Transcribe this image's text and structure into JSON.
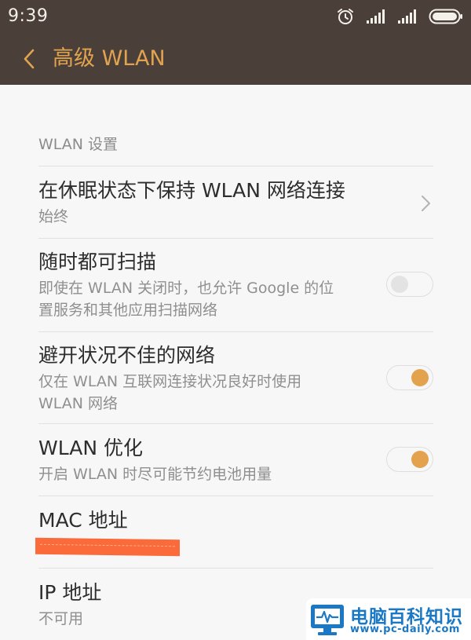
{
  "status_bar": {
    "time": "9:39",
    "icons": [
      "alarm-icon",
      "signal-icon",
      "signal-icon",
      "battery-icon"
    ]
  },
  "header": {
    "title": "高级 WLAN",
    "back_icon": "chevron-left-icon"
  },
  "section": {
    "label": "WLAN 设置"
  },
  "settings": [
    {
      "title": "在休眠状态下保持 WLAN 网络连接",
      "subtitle": "始终",
      "control": "chevron"
    },
    {
      "title": "随时都可扫描",
      "subtitle_lines": [
        "即使在 WLAN 关闭时，也允许 Google 的位",
        "置服务和其他应用扫描网络"
      ],
      "control": "toggle",
      "enabled": false
    },
    {
      "title": "避开状况不佳的网络",
      "subtitle_lines": [
        "仅在 WLAN 互联网连接状况良好时使用",
        "WLAN 网络"
      ],
      "control": "toggle",
      "enabled": true
    },
    {
      "title": "WLAN 优化",
      "subtitle": "开启 WLAN 时尽可能节约电池用量",
      "control": "toggle",
      "enabled": true
    },
    {
      "title": "MAC 地址",
      "value_redacted": true
    },
    {
      "title": "IP 地址",
      "subtitle": "不可用"
    }
  ],
  "watermark": {
    "title": "电脑百科知识",
    "url": "www.pc-daily.com"
  },
  "colors": {
    "header_bg": "#4b3f3a",
    "accent": "#e2a34f",
    "toggle_on": "#e3a24e",
    "redaction": "#fb6a3a",
    "watermark_blue": "#1a78c5"
  }
}
